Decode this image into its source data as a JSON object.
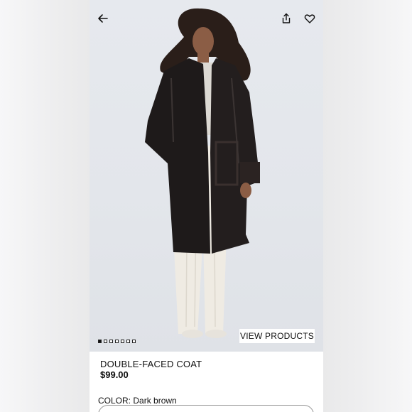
{
  "header": {
    "back_icon": "arrow-left-icon",
    "share_icon": "share-icon",
    "favorite_icon": "heart-icon"
  },
  "gallery": {
    "image_count": 7,
    "active_index": 0,
    "view_products_label": "VIEW PRODUCTS"
  },
  "product": {
    "name": "DOUBLE-FACED COAT",
    "price": "$99.00",
    "color_label": "COLOR:",
    "color_value": "Dark brown"
  },
  "colors": {
    "text": "#111111",
    "photo_bg": "#e4e7ec",
    "coat": "#1e1a1a",
    "pants": "#efebe3"
  }
}
